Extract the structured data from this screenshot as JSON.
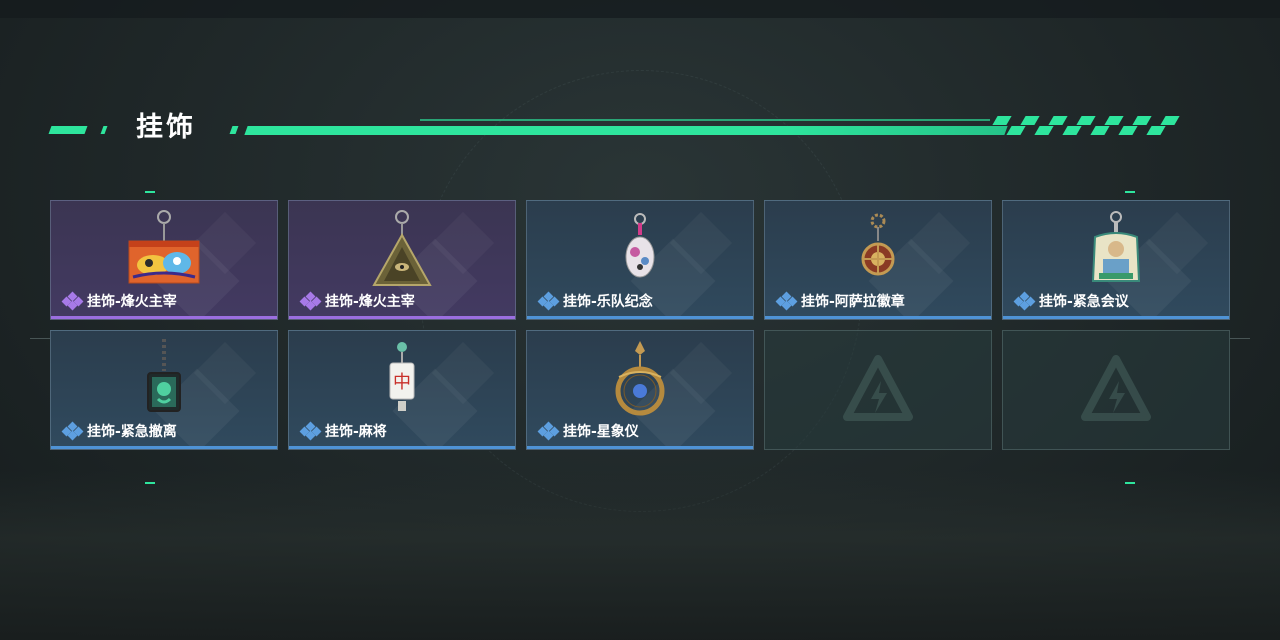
{
  "section": {
    "title": "挂饰"
  },
  "colors": {
    "accent": "#2ee59d",
    "rare_purple": "#9b6fe0",
    "rare_blue": "#4f93d6"
  },
  "items": [
    {
      "label": "挂饰-烽火主宰",
      "rarity": "purple",
      "icon": "graffiti-crate-charm-icon"
    },
    {
      "label": "挂饰-烽火主宰",
      "rarity": "purple",
      "icon": "pyramid-charm-icon"
    },
    {
      "label": "挂饰-乐队纪念",
      "rarity": "blue",
      "icon": "band-badge-charm-icon"
    },
    {
      "label": "挂饰-阿萨拉徽章",
      "rarity": "blue",
      "icon": "asala-medal-charm-icon"
    },
    {
      "label": "挂饰-紧急会议",
      "rarity": "blue",
      "icon": "meeting-acrylic-charm-icon"
    },
    {
      "label": "挂饰-紧急撤离",
      "rarity": "blue",
      "icon": "evacuation-tag-charm-icon"
    },
    {
      "label": "挂饰-麻将",
      "rarity": "blue",
      "icon": "mahjong-tile-charm-icon"
    },
    {
      "label": "挂饰-星象仪",
      "rarity": "blue",
      "icon": "astrolabe-charm-icon"
    }
  ],
  "empty_slots": 2
}
